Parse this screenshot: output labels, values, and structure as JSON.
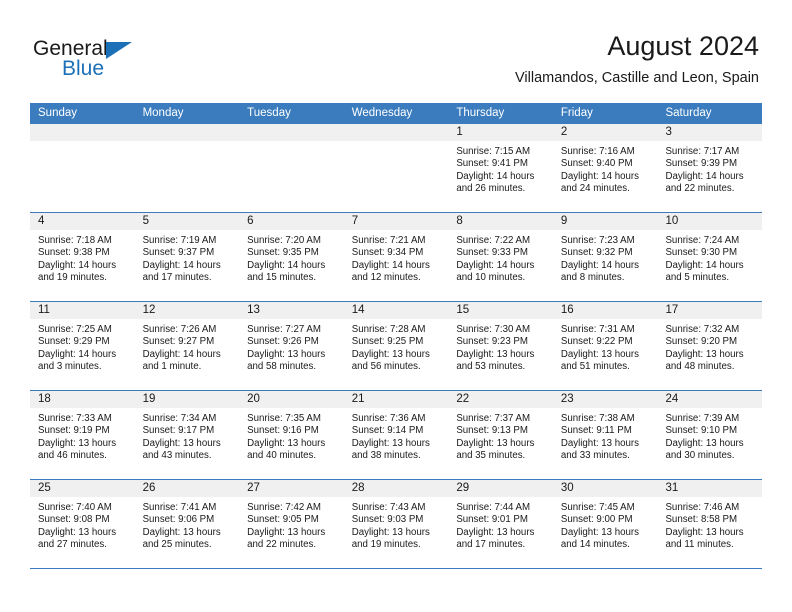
{
  "brand": {
    "name_part1": "General",
    "name_part2": "Blue",
    "accent_color": "#1c70b8"
  },
  "header": {
    "title": "August 2024",
    "subtitle": "Villamandos, Castille and Leon, Spain"
  },
  "calendar": {
    "header_bg": "#3a7cbe",
    "weekdays": [
      "Sunday",
      "Monday",
      "Tuesday",
      "Wednesday",
      "Thursday",
      "Friday",
      "Saturday"
    ],
    "weeks": [
      [
        {
          "day": "",
          "sunrise": "",
          "sunset": "",
          "daylight1": "",
          "daylight2": ""
        },
        {
          "day": "",
          "sunrise": "",
          "sunset": "",
          "daylight1": "",
          "daylight2": ""
        },
        {
          "day": "",
          "sunrise": "",
          "sunset": "",
          "daylight1": "",
          "daylight2": ""
        },
        {
          "day": "",
          "sunrise": "",
          "sunset": "",
          "daylight1": "",
          "daylight2": ""
        },
        {
          "day": "1",
          "sunrise": "Sunrise: 7:15 AM",
          "sunset": "Sunset: 9:41 PM",
          "daylight1": "Daylight: 14 hours",
          "daylight2": "and 26 minutes."
        },
        {
          "day": "2",
          "sunrise": "Sunrise: 7:16 AM",
          "sunset": "Sunset: 9:40 PM",
          "daylight1": "Daylight: 14 hours",
          "daylight2": "and 24 minutes."
        },
        {
          "day": "3",
          "sunrise": "Sunrise: 7:17 AM",
          "sunset": "Sunset: 9:39 PM",
          "daylight1": "Daylight: 14 hours",
          "daylight2": "and 22 minutes."
        }
      ],
      [
        {
          "day": "4",
          "sunrise": "Sunrise: 7:18 AM",
          "sunset": "Sunset: 9:38 PM",
          "daylight1": "Daylight: 14 hours",
          "daylight2": "and 19 minutes."
        },
        {
          "day": "5",
          "sunrise": "Sunrise: 7:19 AM",
          "sunset": "Sunset: 9:37 PM",
          "daylight1": "Daylight: 14 hours",
          "daylight2": "and 17 minutes."
        },
        {
          "day": "6",
          "sunrise": "Sunrise: 7:20 AM",
          "sunset": "Sunset: 9:35 PM",
          "daylight1": "Daylight: 14 hours",
          "daylight2": "and 15 minutes."
        },
        {
          "day": "7",
          "sunrise": "Sunrise: 7:21 AM",
          "sunset": "Sunset: 9:34 PM",
          "daylight1": "Daylight: 14 hours",
          "daylight2": "and 12 minutes."
        },
        {
          "day": "8",
          "sunrise": "Sunrise: 7:22 AM",
          "sunset": "Sunset: 9:33 PM",
          "daylight1": "Daylight: 14 hours",
          "daylight2": "and 10 minutes."
        },
        {
          "day": "9",
          "sunrise": "Sunrise: 7:23 AM",
          "sunset": "Sunset: 9:32 PM",
          "daylight1": "Daylight: 14 hours",
          "daylight2": "and 8 minutes."
        },
        {
          "day": "10",
          "sunrise": "Sunrise: 7:24 AM",
          "sunset": "Sunset: 9:30 PM",
          "daylight1": "Daylight: 14 hours",
          "daylight2": "and 5 minutes."
        }
      ],
      [
        {
          "day": "11",
          "sunrise": "Sunrise: 7:25 AM",
          "sunset": "Sunset: 9:29 PM",
          "daylight1": "Daylight: 14 hours",
          "daylight2": "and 3 minutes."
        },
        {
          "day": "12",
          "sunrise": "Sunrise: 7:26 AM",
          "sunset": "Sunset: 9:27 PM",
          "daylight1": "Daylight: 14 hours",
          "daylight2": "and 1 minute."
        },
        {
          "day": "13",
          "sunrise": "Sunrise: 7:27 AM",
          "sunset": "Sunset: 9:26 PM",
          "daylight1": "Daylight: 13 hours",
          "daylight2": "and 58 minutes."
        },
        {
          "day": "14",
          "sunrise": "Sunrise: 7:28 AM",
          "sunset": "Sunset: 9:25 PM",
          "daylight1": "Daylight: 13 hours",
          "daylight2": "and 56 minutes."
        },
        {
          "day": "15",
          "sunrise": "Sunrise: 7:30 AM",
          "sunset": "Sunset: 9:23 PM",
          "daylight1": "Daylight: 13 hours",
          "daylight2": "and 53 minutes."
        },
        {
          "day": "16",
          "sunrise": "Sunrise: 7:31 AM",
          "sunset": "Sunset: 9:22 PM",
          "daylight1": "Daylight: 13 hours",
          "daylight2": "and 51 minutes."
        },
        {
          "day": "17",
          "sunrise": "Sunrise: 7:32 AM",
          "sunset": "Sunset: 9:20 PM",
          "daylight1": "Daylight: 13 hours",
          "daylight2": "and 48 minutes."
        }
      ],
      [
        {
          "day": "18",
          "sunrise": "Sunrise: 7:33 AM",
          "sunset": "Sunset: 9:19 PM",
          "daylight1": "Daylight: 13 hours",
          "daylight2": "and 46 minutes."
        },
        {
          "day": "19",
          "sunrise": "Sunrise: 7:34 AM",
          "sunset": "Sunset: 9:17 PM",
          "daylight1": "Daylight: 13 hours",
          "daylight2": "and 43 minutes."
        },
        {
          "day": "20",
          "sunrise": "Sunrise: 7:35 AM",
          "sunset": "Sunset: 9:16 PM",
          "daylight1": "Daylight: 13 hours",
          "daylight2": "and 40 minutes."
        },
        {
          "day": "21",
          "sunrise": "Sunrise: 7:36 AM",
          "sunset": "Sunset: 9:14 PM",
          "daylight1": "Daylight: 13 hours",
          "daylight2": "and 38 minutes."
        },
        {
          "day": "22",
          "sunrise": "Sunrise: 7:37 AM",
          "sunset": "Sunset: 9:13 PM",
          "daylight1": "Daylight: 13 hours",
          "daylight2": "and 35 minutes."
        },
        {
          "day": "23",
          "sunrise": "Sunrise: 7:38 AM",
          "sunset": "Sunset: 9:11 PM",
          "daylight1": "Daylight: 13 hours",
          "daylight2": "and 33 minutes."
        },
        {
          "day": "24",
          "sunrise": "Sunrise: 7:39 AM",
          "sunset": "Sunset: 9:10 PM",
          "daylight1": "Daylight: 13 hours",
          "daylight2": "and 30 minutes."
        }
      ],
      [
        {
          "day": "25",
          "sunrise": "Sunrise: 7:40 AM",
          "sunset": "Sunset: 9:08 PM",
          "daylight1": "Daylight: 13 hours",
          "daylight2": "and 27 minutes."
        },
        {
          "day": "26",
          "sunrise": "Sunrise: 7:41 AM",
          "sunset": "Sunset: 9:06 PM",
          "daylight1": "Daylight: 13 hours",
          "daylight2": "and 25 minutes."
        },
        {
          "day": "27",
          "sunrise": "Sunrise: 7:42 AM",
          "sunset": "Sunset: 9:05 PM",
          "daylight1": "Daylight: 13 hours",
          "daylight2": "and 22 minutes."
        },
        {
          "day": "28",
          "sunrise": "Sunrise: 7:43 AM",
          "sunset": "Sunset: 9:03 PM",
          "daylight1": "Daylight: 13 hours",
          "daylight2": "and 19 minutes."
        },
        {
          "day": "29",
          "sunrise": "Sunrise: 7:44 AM",
          "sunset": "Sunset: 9:01 PM",
          "daylight1": "Daylight: 13 hours",
          "daylight2": "and 17 minutes."
        },
        {
          "day": "30",
          "sunrise": "Sunrise: 7:45 AM",
          "sunset": "Sunset: 9:00 PM",
          "daylight1": "Daylight: 13 hours",
          "daylight2": "and 14 minutes."
        },
        {
          "day": "31",
          "sunrise": "Sunrise: 7:46 AM",
          "sunset": "Sunset: 8:58 PM",
          "daylight1": "Daylight: 13 hours",
          "daylight2": "and 11 minutes."
        }
      ]
    ]
  }
}
